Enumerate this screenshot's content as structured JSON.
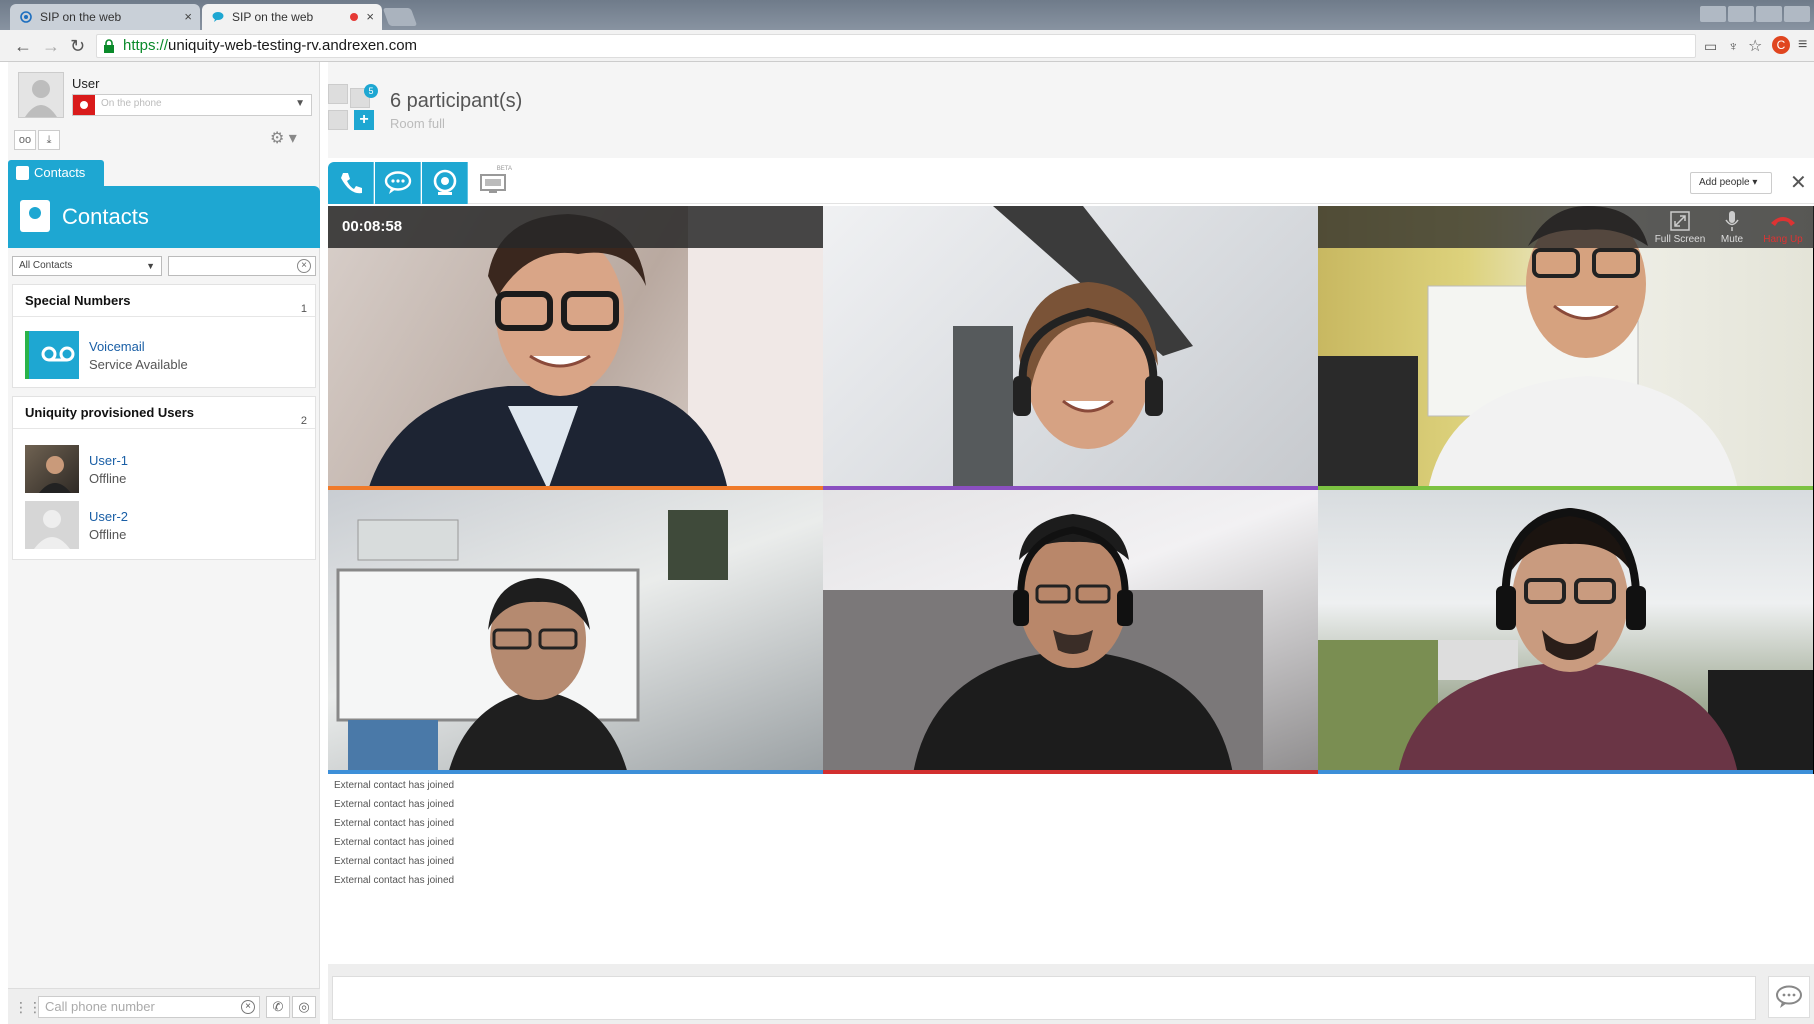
{
  "browser": {
    "tabs": [
      {
        "title": "SIP on the web",
        "active": false
      },
      {
        "title": "SIP on the web",
        "active": true
      }
    ],
    "url_scheme": "https://",
    "url_rest": "uniquity-web-testing-rv.andrexen.com"
  },
  "user": {
    "name": "User",
    "status_placeholder": "On the phone",
    "status_color": "#d91b1b"
  },
  "contacts": {
    "tab_label": "Contacts",
    "header_label": "Contacts",
    "filter_selected": "All Contacts",
    "groups": [
      {
        "title": "Special Numbers",
        "count": "1",
        "entries": [
          {
            "name": "Voicemail",
            "status": "Service Available"
          }
        ]
      },
      {
        "title": "Uniquity provisioned Users",
        "count": "2",
        "entries": [
          {
            "name": "User-1",
            "status": "Offline"
          },
          {
            "name": "User-2",
            "status": "Offline"
          }
        ]
      }
    ]
  },
  "call_bar": {
    "placeholder": "Call phone number"
  },
  "room": {
    "badge": "5",
    "participants": "6 participant(s)",
    "status": "Room full",
    "add_people": "Add people",
    "beta": "BETA"
  },
  "video": {
    "timer": "00:08:58",
    "controls": [
      {
        "label": "Full Screen"
      },
      {
        "label": "Mute"
      },
      {
        "label": "Hang Up"
      }
    ],
    "tile_colors": [
      "#f07a2a",
      "#8a4fc0",
      "#7cc242",
      "#3d8fd8",
      "#d22f2f",
      "#3d8fd8"
    ]
  },
  "log": [
    "External contact has joined",
    "External contact has joined",
    "External contact has joined",
    "External contact has joined",
    "External contact has joined",
    "External contact has joined"
  ],
  "colors": {
    "accent": "#1ea7d2",
    "voicemail_bar": "#2ab34a"
  }
}
